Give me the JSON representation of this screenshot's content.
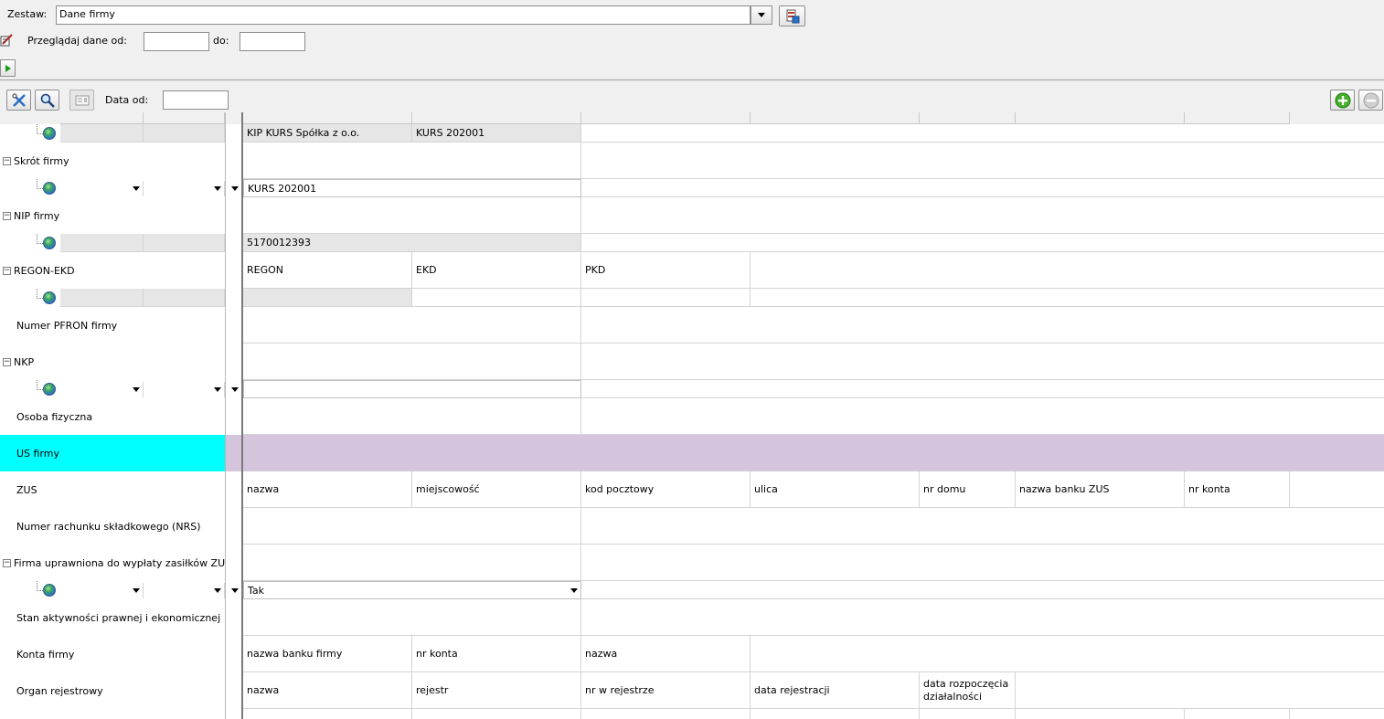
{
  "header": {
    "zestaw_label": "Zestaw:",
    "zestaw_value": "Dane firmy",
    "browse_label": "Przeglądaj dane od:",
    "from_value": "",
    "to_label": "do:",
    "to_value": ""
  },
  "toolbar": {
    "date_from_label": "Data od:",
    "date_from_value": ""
  },
  "rows": {
    "r0_col1": "KIP KURS Spółka z o.o.",
    "r0_col2": "KURS 202001",
    "skrot_label": "Skrót firmy",
    "skrot_value": "KURS 202001",
    "nip_label": "NIP firmy",
    "nip_value": "5170012393",
    "regon_label": "REGON-EKD",
    "regon_h1": "REGON",
    "regon_h2": "EKD",
    "regon_h3": "PKD",
    "pfron_label": "Numer PFRON firmy",
    "nkp_label": "NKP",
    "osoba_label": "Osoba fizyczna",
    "us_label": "US firmy",
    "zus_label": "ZUS",
    "zus_h1": "nazwa",
    "zus_h2": "miejscowość",
    "zus_h3": "kod pocztowy",
    "zus_h4": "ulica",
    "zus_h5": "nr domu",
    "zus_h6": "nazwa banku ZUS",
    "zus_h7": "nr konta",
    "nrs_label": "Numer rachunku składkowego (NRS)",
    "firma_upr_label": "Firma uprawniona do wypłaty zasiłków ZUS",
    "firma_upr_value": "Tak",
    "stan_label": "Stan aktywności prawnej i ekonomicznej",
    "konta_label": "Konta firmy",
    "konta_h1": "nazwa banku firmy",
    "konta_h2": "nr konta",
    "konta_h3": "nazwa",
    "organ_label": "Organ rejestrowy",
    "organ_h1": "nazwa",
    "organ_h2": "rejestr",
    "organ_h3": "nr w rejestrze",
    "organ_h4": "data rejestracji",
    "organ_h5": "data rozpoczęcia działalności"
  },
  "colors": {
    "selected_row_label": "#00ffff",
    "selected_row_fill": "#d4c4dc"
  }
}
